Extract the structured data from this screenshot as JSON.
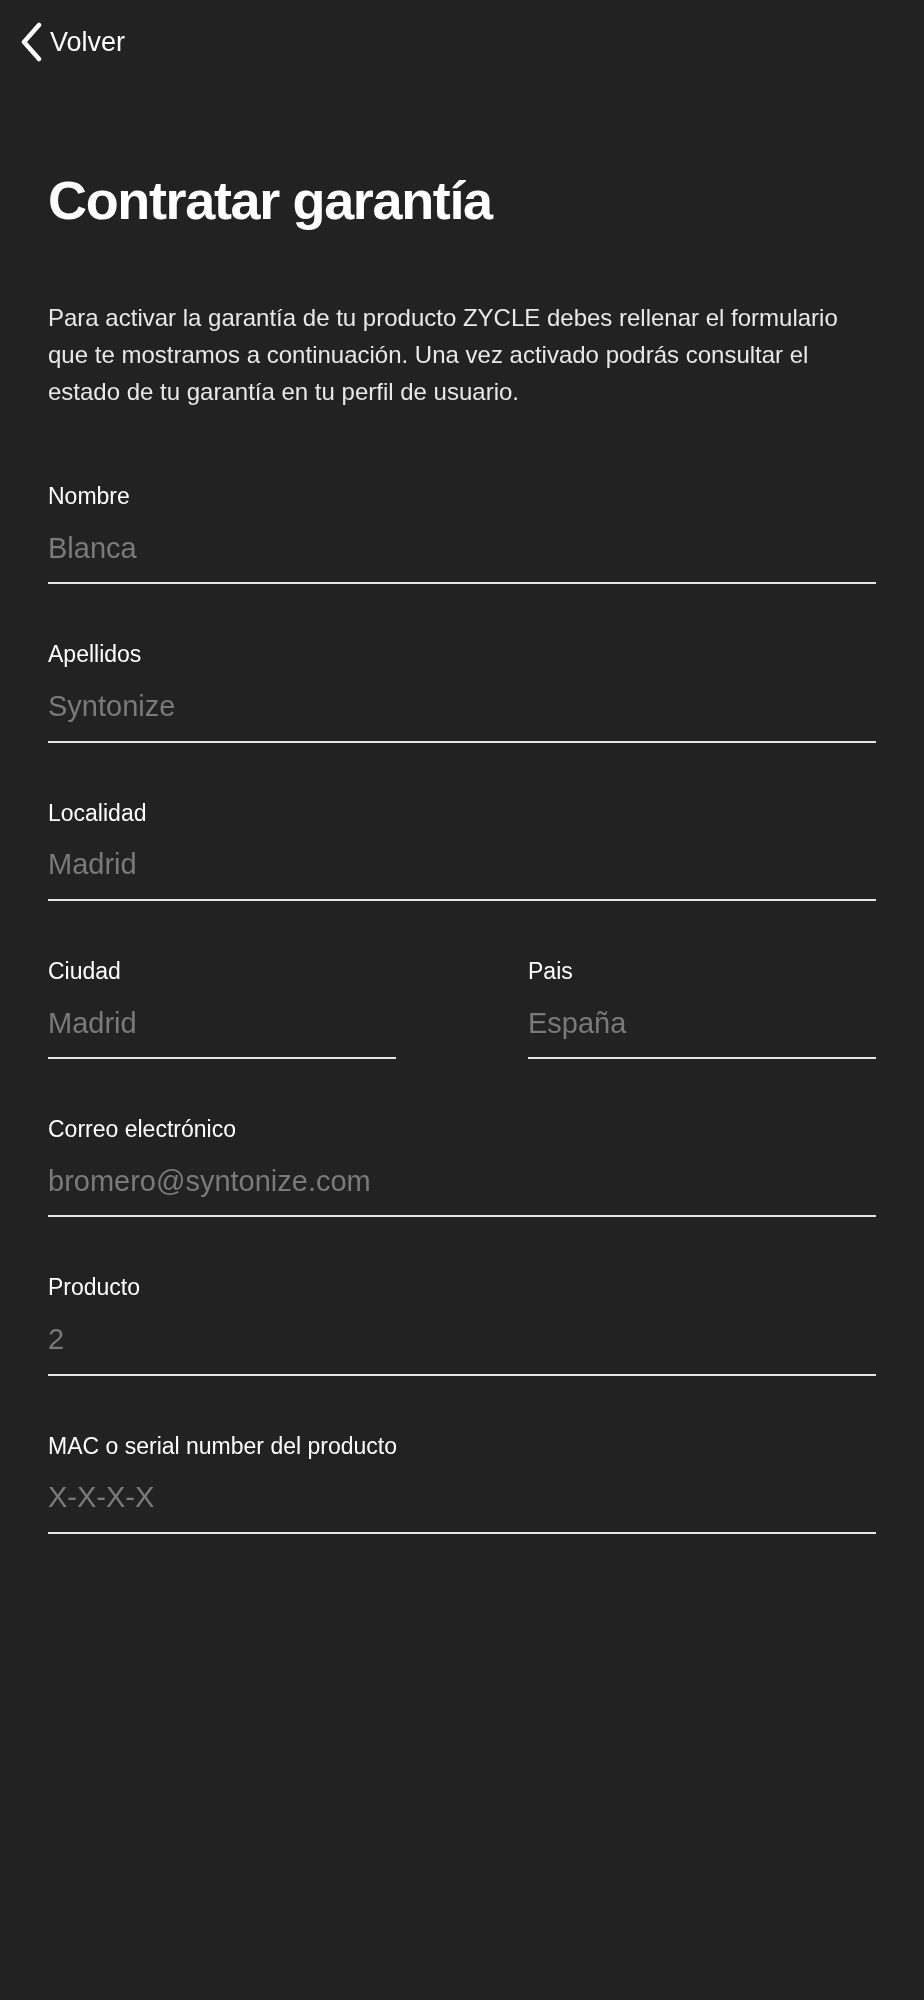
{
  "back": {
    "label": "Volver"
  },
  "title": "Contratar garantía",
  "intro": "Para activar la garantía de tu producto ZYCLE debes rellenar el formulario que te mostramos a continuación. Una vez activado podrás consultar el estado de tu garantía en tu perfil de usuario.",
  "fields": [
    {
      "label": "Nombre",
      "placeholder": "Blanca"
    },
    {
      "label": "Apellidos",
      "placeholder": "Syntonize"
    },
    {
      "label": "Localidad",
      "placeholder": "Madrid"
    },
    {
      "kind": "pair",
      "items": [
        {
          "label": "Ciudad",
          "placeholder": "Madrid"
        },
        {
          "label": "Pais",
          "placeholder": "España"
        }
      ]
    },
    {
      "label": "Correo electrónico",
      "placeholder": "bromero@syntonize.com"
    },
    {
      "label": "Producto",
      "placeholder": "2"
    },
    {
      "label": "MAC o serial number del producto",
      "placeholder": "X-X-X-X"
    }
  ]
}
